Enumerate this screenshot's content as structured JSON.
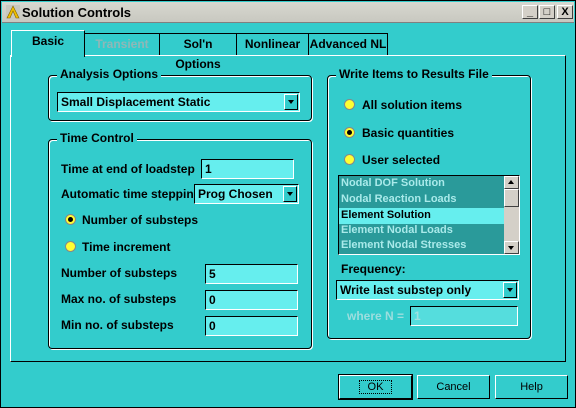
{
  "window": {
    "title": "Solution Controls"
  },
  "titlebar": {
    "minimize": "_",
    "maximize": "□",
    "close": "X"
  },
  "tabs": [
    {
      "label": "Basic"
    },
    {
      "label": "Transient"
    },
    {
      "label": "Sol'n Options"
    },
    {
      "label": "Nonlinear"
    },
    {
      "label": "Advanced NL"
    }
  ],
  "analysis": {
    "group_label": "Analysis Options",
    "selected": "Small Displacement Static"
  },
  "time_control": {
    "group_label": "Time Control",
    "time_end_label": "Time at end of loadstep",
    "time_end_value": "1",
    "auto_step_label": "Automatic time stepping",
    "auto_step_value": "Prog Chosen",
    "radio_substeps": "Number of substeps",
    "radio_increment": "Time increment",
    "num_substeps_label": "Number of substeps",
    "num_substeps_value": "5",
    "max_substeps_label": "Max no. of substeps",
    "max_substeps_value": "0",
    "min_substeps_label": "Min no. of substeps",
    "min_substeps_value": "0"
  },
  "results": {
    "group_label": "Write Items to Results File",
    "radio_all": "All solution items",
    "radio_basic": "Basic quantities",
    "radio_user": "User selected",
    "list_items": [
      "Nodal DOF Solution",
      "Nodal Reaction Loads",
      "Element Solution",
      "Element Nodal Loads",
      "Element Nodal Stresses"
    ],
    "frequency_label": "Frequency:",
    "frequency_value": "Write last substep only",
    "where_label": "where N =",
    "where_value": "1"
  },
  "buttons": {
    "ok": "OK",
    "cancel": "Cancel",
    "help": "Help"
  },
  "colors": {
    "background": "#33cccc",
    "field": "#66eeee",
    "radio": "#ffff33"
  }
}
